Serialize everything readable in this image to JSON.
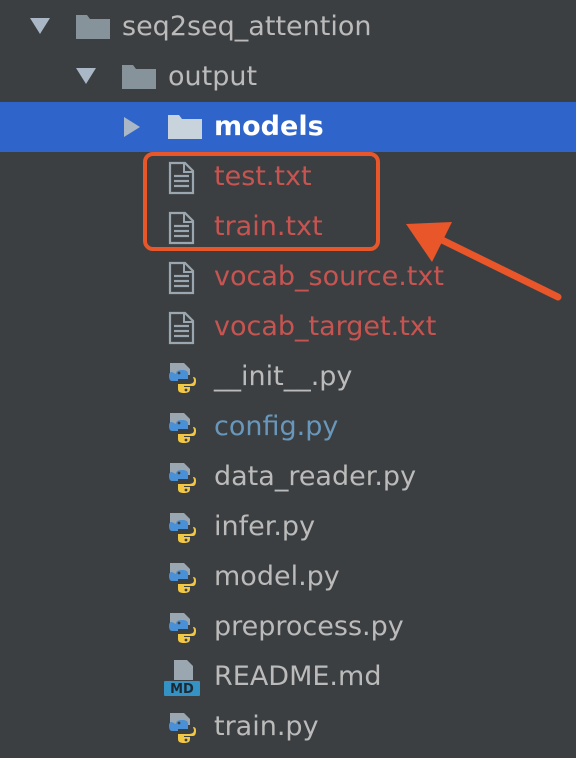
{
  "colors": {
    "background": "#3c3f41",
    "selection": "#2f65ca",
    "default_text": "#bbbbbb",
    "selected_text": "#ffffff",
    "ignored_text": "#c75450",
    "modified_text": "#6897bb",
    "folder_icon": "#87939a",
    "highlight": "#e8562a"
  },
  "tree": [
    {
      "name": "seq2seq_attention",
      "type": "folder",
      "expanded": true,
      "depth": 0,
      "status": "normal"
    },
    {
      "name": "output",
      "type": "folder",
      "expanded": true,
      "depth": 1,
      "status": "normal"
    },
    {
      "name": "models",
      "type": "folder",
      "expanded": false,
      "depth": 2,
      "status": "selected"
    },
    {
      "name": "test.txt",
      "type": "text-file",
      "depth": 3,
      "status": "ignored"
    },
    {
      "name": "train.txt",
      "type": "text-file",
      "depth": 3,
      "status": "ignored"
    },
    {
      "name": "vocab_source.txt",
      "type": "text-file",
      "depth": 3,
      "status": "ignored"
    },
    {
      "name": "vocab_target.txt",
      "type": "text-file",
      "depth": 3,
      "status": "ignored"
    },
    {
      "name": "__init__.py",
      "type": "python-file",
      "depth": 2,
      "status": "normal"
    },
    {
      "name": "config.py",
      "type": "python-file",
      "depth": 2,
      "status": "modified"
    },
    {
      "name": "data_reader.py",
      "type": "python-file",
      "depth": 2,
      "status": "normal"
    },
    {
      "name": "infer.py",
      "type": "python-file",
      "depth": 2,
      "status": "normal"
    },
    {
      "name": "model.py",
      "type": "python-file",
      "depth": 2,
      "status": "normal"
    },
    {
      "name": "preprocess.py",
      "type": "python-file",
      "depth": 2,
      "status": "normal"
    },
    {
      "name": "README.md",
      "type": "markdown-file",
      "depth": 2,
      "status": "normal"
    },
    {
      "name": "train.py",
      "type": "python-file",
      "depth": 2,
      "status": "normal"
    }
  ],
  "icons": {
    "folder": "folder-icon",
    "text-file": "text-file-icon",
    "python-file": "python-file-icon",
    "markdown-file": "markdown-file-icon",
    "markdown_badge": "MD",
    "expanded": "chevron-down-icon",
    "collapsed": "chevron-right-icon"
  },
  "annotation": {
    "box_color": "#e8562a",
    "arrow_color": "#e8562a",
    "highlighted_items": [
      "test.txt",
      "train.txt"
    ]
  }
}
